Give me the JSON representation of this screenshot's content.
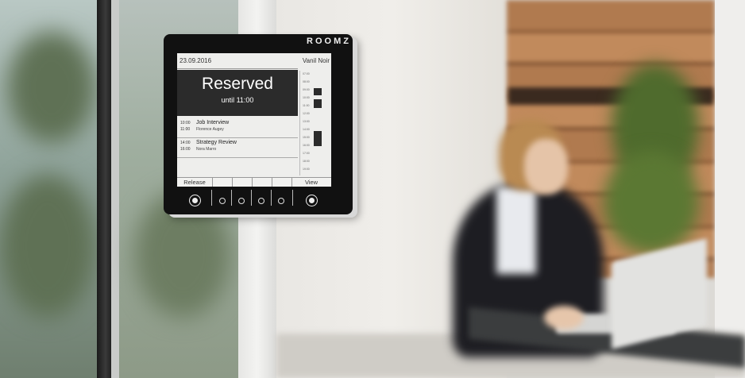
{
  "device": {
    "brand": "ROOMZ",
    "date": "23.09.2016",
    "room": "Vanil Noir",
    "status_title": "Reserved",
    "status_subtitle": "until 11:00",
    "events": [
      {
        "start": "10:00",
        "end": "11:00",
        "title": "Job Interview",
        "organizer": "Florence Augey"
      },
      {
        "start": "14:00",
        "end": "16:00",
        "title": "Strategy Review",
        "organizer": "Nora Marro"
      }
    ],
    "timeline_labels": [
      "07:00",
      "08:00",
      "09:00",
      "10:00",
      "11:00",
      "12:00",
      "13:00",
      "14:00",
      "15:00",
      "16:00",
      "17:00",
      "18:00",
      "19:00"
    ],
    "softkeys": {
      "release": "Release",
      "view": "View"
    }
  },
  "colors": {
    "screen_bg": "#eeeeec",
    "status_bg": "#2b2b2b",
    "bezel": "#111111"
  }
}
